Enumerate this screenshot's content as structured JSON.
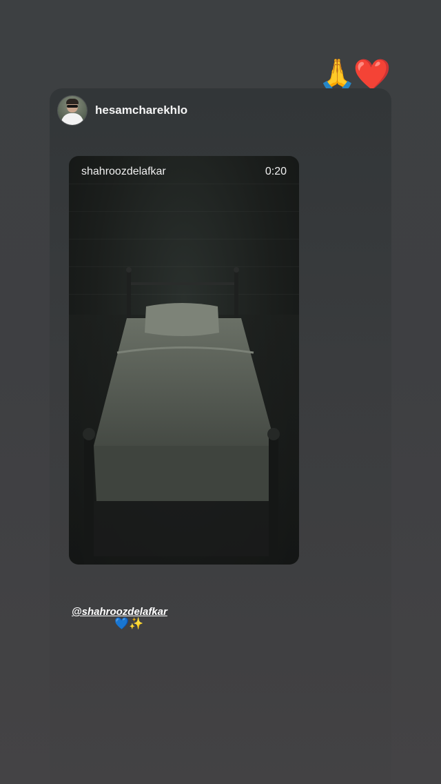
{
  "story": {
    "reaction_emojis": "🙏❤️",
    "author": {
      "username": "hesamcharekhlo"
    },
    "shared_post": {
      "username": "shahroozdelafkar",
      "duration": "0:20"
    },
    "caption": {
      "mention": "@shahroozdelafkar",
      "emojis": "💙✨"
    }
  }
}
